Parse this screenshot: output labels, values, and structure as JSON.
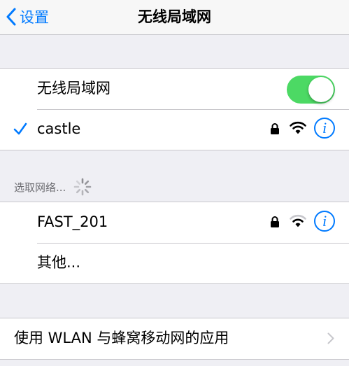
{
  "nav": {
    "back_label": "设置",
    "title": "无线局域网"
  },
  "wifi_toggle": {
    "label": "无线局域网",
    "on": true,
    "color": "#4cd964"
  },
  "connected_network": {
    "name": "castle",
    "secured": true,
    "checkmark_icon": "checkmark-icon"
  },
  "section": {
    "header": "选取网络..."
  },
  "networks": [
    {
      "name": "FAST_201",
      "secured": true
    }
  ],
  "other_label": "其他...",
  "wlan_cellular_label": "使用 WLAN 与蜂窝移动网的应用",
  "colors": {
    "accent": "#007aff",
    "background": "#efeff4"
  }
}
